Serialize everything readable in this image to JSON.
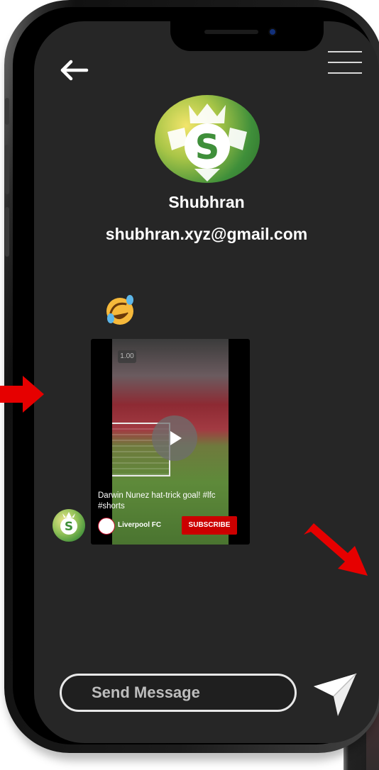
{
  "profile": {
    "name": "Shubhran",
    "email": "shubhran.xyz@gmail.com"
  },
  "video": {
    "timer": "1.00",
    "caption": "Darwin Nunez hat-trick goal! #lfc #shorts",
    "channel": "Liverpool FC",
    "subscribe_label": "SUBSCRIBE"
  },
  "composer": {
    "placeholder": "Send Message"
  },
  "icons": {
    "back": "back-arrow-icon",
    "menu": "hamburger-menu-icon",
    "send": "paper-plane-send-icon",
    "reaction": "rolling-on-floor-laughing-emoji"
  },
  "colors": {
    "screen_bg": "#262626",
    "accent_red": "#e60000",
    "subscribe_red": "#cc0000",
    "text_primary": "#ffffff"
  }
}
